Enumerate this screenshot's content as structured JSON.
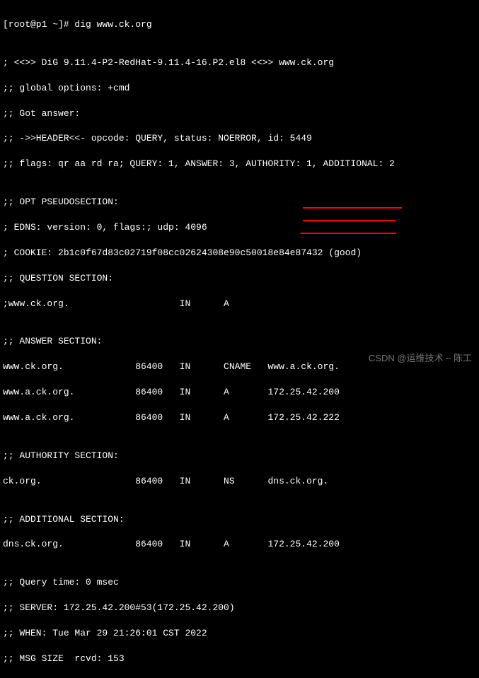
{
  "prompt": "[root@p1 ~]# dig www.ck.org",
  "blank": "",
  "header1": "; <<>> DiG 9.11.4-P2-RedHat-9.11.4-16.P2.el8 <<>> www.ck.org",
  "header2": ";; global options: +cmd",
  "header3": ";; Got answer:",
  "header4": ";; ->>HEADER<<- opcode: QUERY, status: NOERROR, id: 5449",
  "header5": ";; flags: qr aa rd ra; QUERY: 1, ANSWER: 3, AUTHORITY: 1, ADDITIONAL: 2",
  "opt_title": ";; OPT PSEUDOSECTION:",
  "opt1": "; EDNS: version: 0, flags:; udp: 4096",
  "opt2": "; COOKIE: 2b1c0f67d83c02719f08cc02624308e90c50018e84e87432 (good)",
  "question_title": ";; QUESTION SECTION:",
  "question1": ";www.ck.org.                    IN      A",
  "answer_title": ";; ANSWER SECTION:",
  "answer1": "www.ck.org.             86400   IN      CNAME   www.a.ck.org.",
  "answer2": "www.a.ck.org.           86400   IN      A       172.25.42.200",
  "answer3": "www.a.ck.org.           86400   IN      A       172.25.42.222",
  "authority_title": ";; AUTHORITY SECTION:",
  "authority1": "ck.org.                 86400   IN      NS      dns.ck.org.",
  "additional_title": ";; ADDITIONAL SECTION:",
  "additional1": "dns.ck.org.             86400   IN      A       172.25.42.200",
  "footer1": ";; Query time: 0 msec",
  "footer2": ";; SERVER: 172.25.42.200#53(172.25.42.200)",
  "footer3": ";; WHEN: Tue Mar 29 21:26:01 CST 2022",
  "footer4": ";; MSG SIZE  rcvd: 153",
  "watermark": "CSDN @运维技术 – 陈工"
}
